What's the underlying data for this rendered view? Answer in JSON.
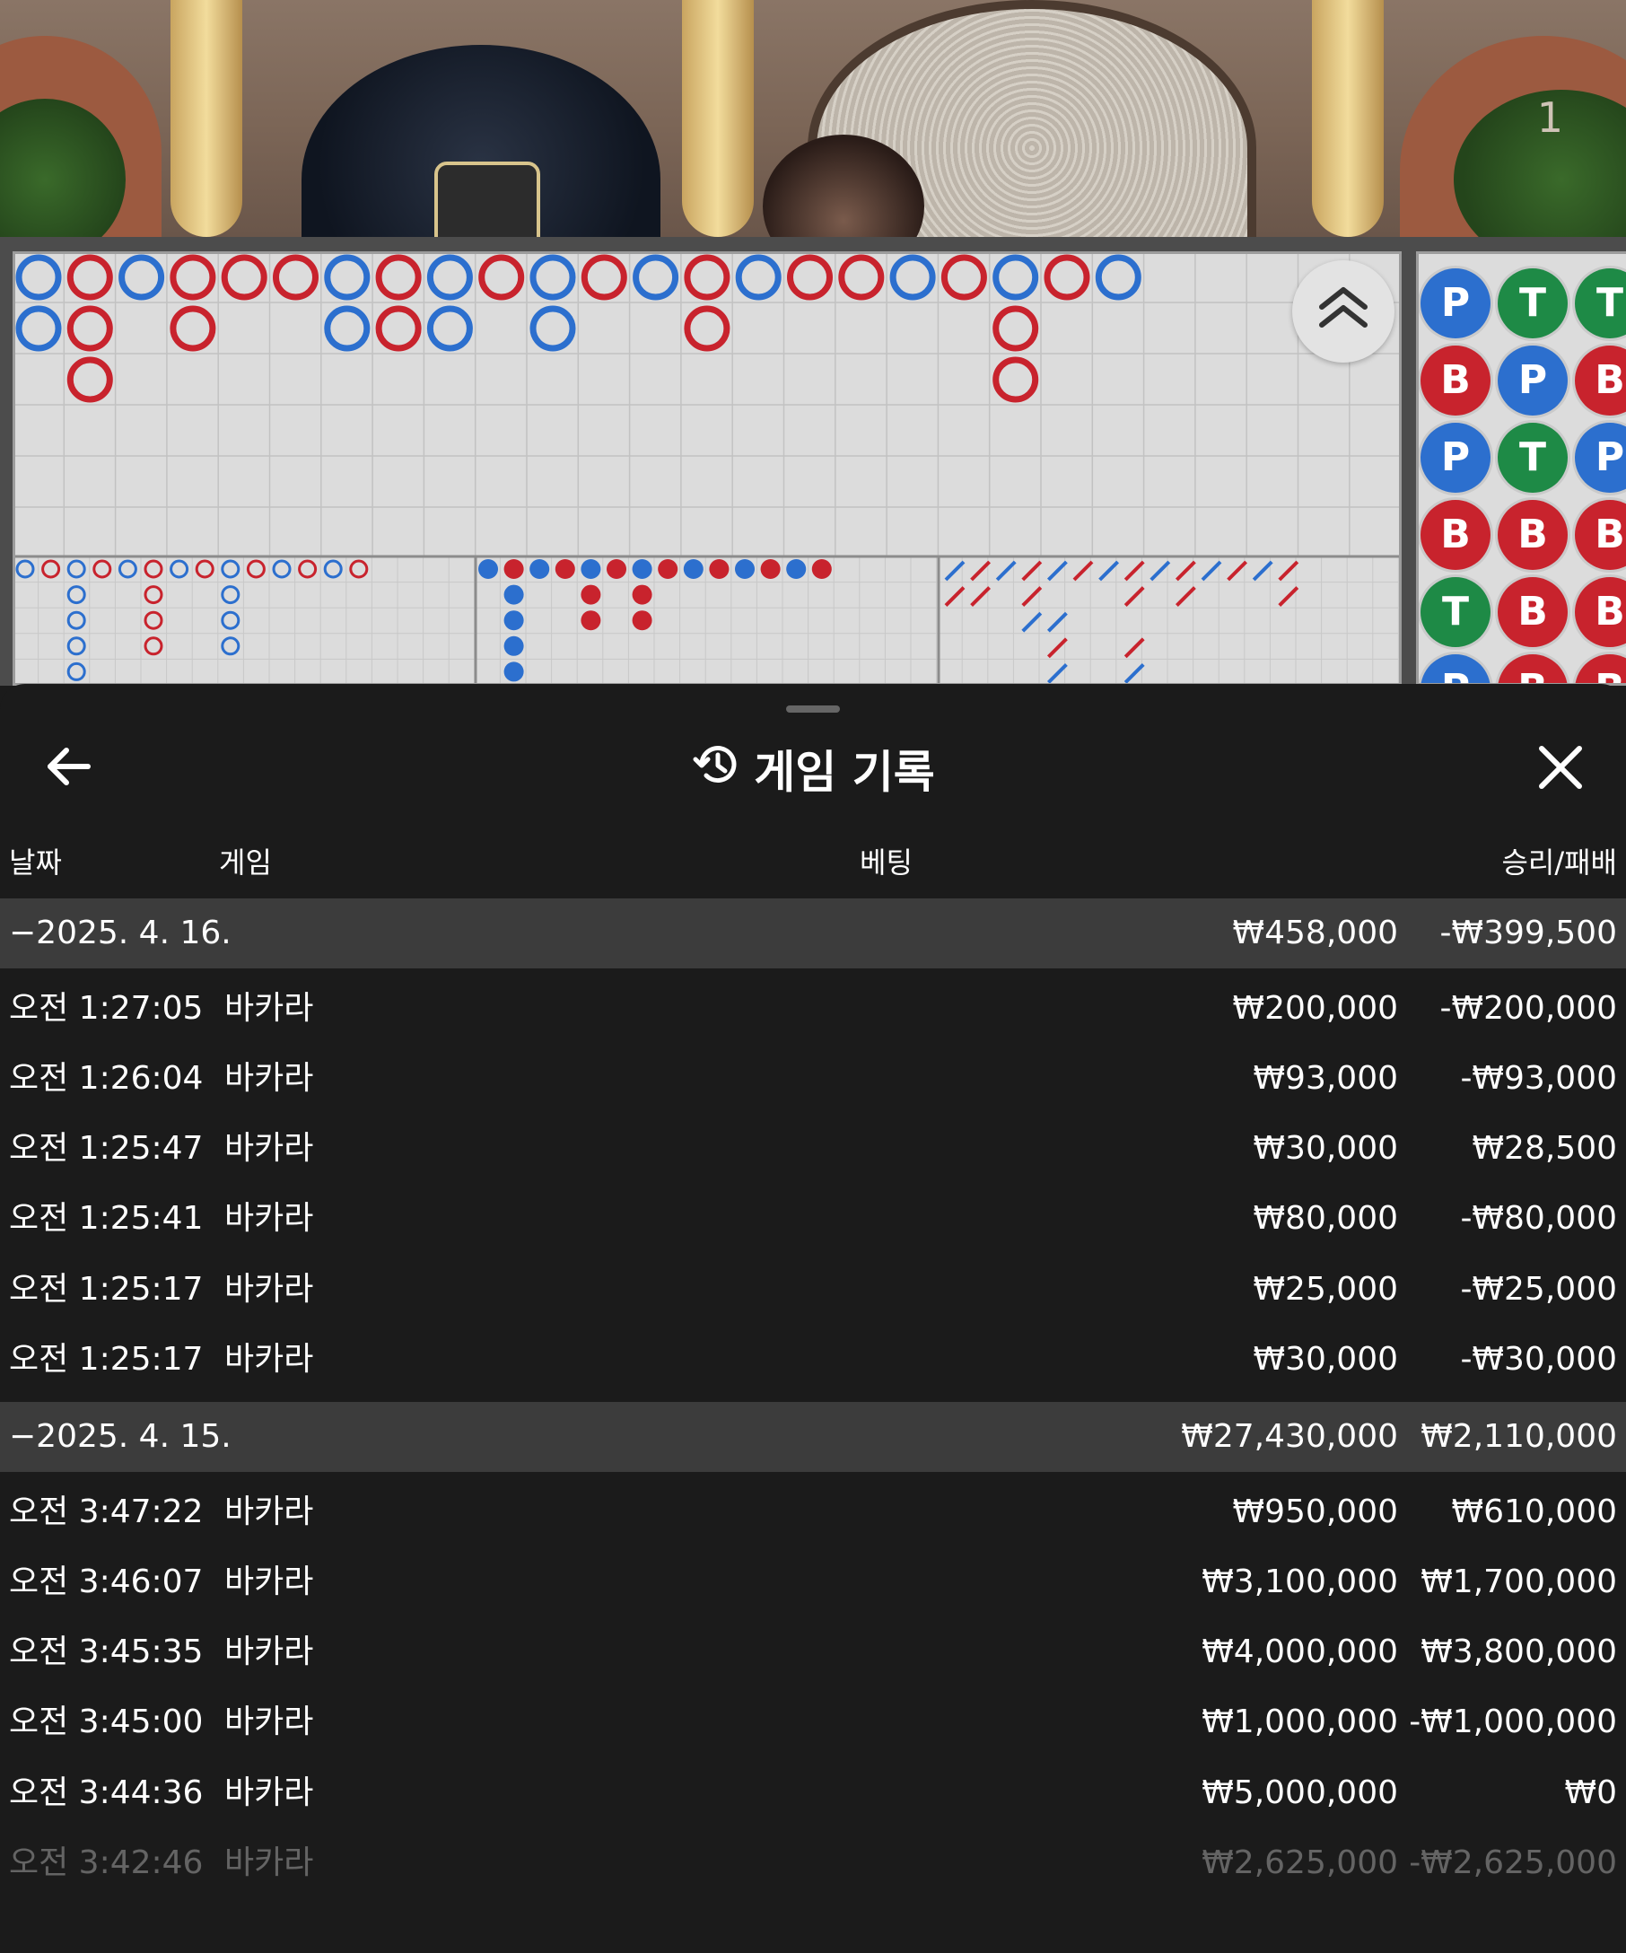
{
  "video": {
    "corner_number": "1"
  },
  "bead_road": {
    "columns": [
      [
        "P",
        "B",
        "P",
        "B",
        "T",
        "P"
      ],
      [
        "T",
        "P",
        "T",
        "B",
        "B",
        "B"
      ],
      [
        "T",
        "B",
        "P",
        "B",
        "B",
        "B"
      ]
    ]
  },
  "history": {
    "title": "게임 기록",
    "columns": {
      "date": "날짜",
      "game": "게임",
      "bet": "베팅",
      "result": "승리/패배"
    },
    "groups": [
      {
        "date": "−2025. 4. 16.",
        "bet_total": "₩458,000",
        "result_total": "-₩399,500",
        "rows": [
          {
            "time": "오전 1:27:05",
            "game": "바카라",
            "bet": "₩200,000",
            "result": "-₩200,000"
          },
          {
            "time": "오전 1:26:04",
            "game": "바카라",
            "bet": "₩93,000",
            "result": "-₩93,000"
          },
          {
            "time": "오전 1:25:47",
            "game": "바카라",
            "bet": "₩30,000",
            "result": "₩28,500"
          },
          {
            "time": "오전 1:25:41",
            "game": "바카라",
            "bet": "₩80,000",
            "result": "-₩80,000"
          },
          {
            "time": "오전 1:25:17",
            "game": "바카라",
            "bet": "₩25,000",
            "result": "-₩25,000"
          },
          {
            "time": "오전 1:25:17",
            "game": "바카라",
            "bet": "₩30,000",
            "result": "-₩30,000"
          }
        ]
      },
      {
        "date": "−2025. 4. 15.",
        "bet_total": "₩27,430,000",
        "result_total": "₩2,110,000",
        "rows": [
          {
            "time": "오전 3:47:22",
            "game": "바카라",
            "bet": "₩950,000",
            "result": "₩610,000"
          },
          {
            "time": "오전 3:46:07",
            "game": "바카라",
            "bet": "₩3,100,000",
            "result": "₩1,700,000"
          },
          {
            "time": "오전 3:45:35",
            "game": "바카라",
            "bet": "₩4,000,000",
            "result": "₩3,800,000"
          },
          {
            "time": "오전 3:45:00",
            "game": "바카라",
            "bet": "₩1,000,000",
            "result": "-₩1,000,000"
          },
          {
            "time": "오전 3:44:36",
            "game": "바카라",
            "bet": "₩5,000,000",
            "result": "₩0"
          },
          {
            "time": "오전 3:42:46",
            "game": "바카라",
            "bet": "₩2,625,000",
            "result": "-₩2,625,000"
          }
        ]
      }
    ]
  },
  "colors": {
    "player": "#2c6fce",
    "banker": "#c8232d",
    "tie": "#1e8a46",
    "sheet_bg": "#1b1b1b",
    "group_bg": "#3c3c3c"
  },
  "icons": {
    "back": "arrow-left-icon",
    "history": "history-clock-icon",
    "close": "close-icon",
    "collapse": "chevron-double-up-icon"
  }
}
